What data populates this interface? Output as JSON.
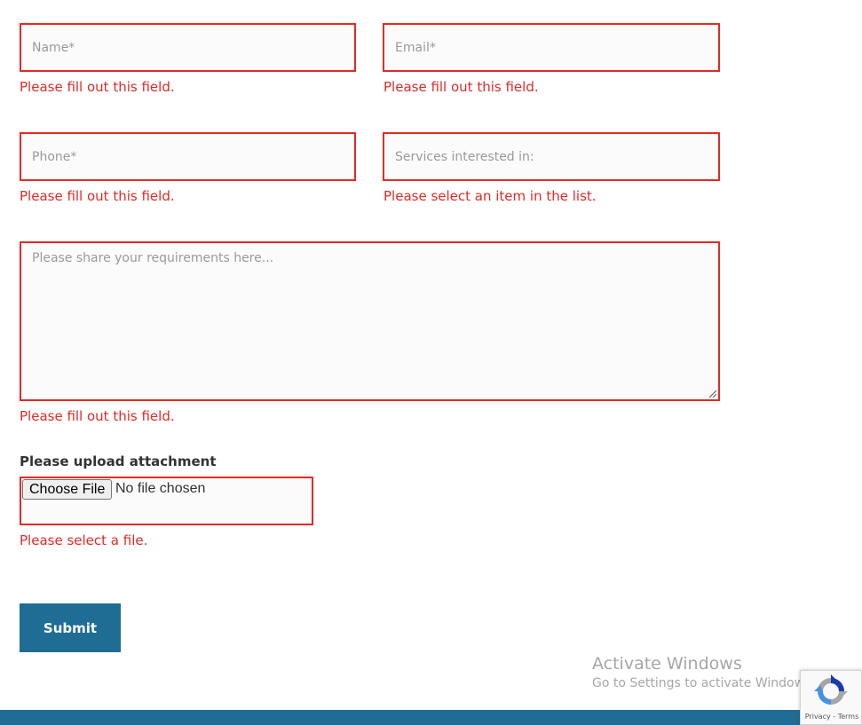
{
  "form": {
    "name": {
      "placeholder": "Name*",
      "error": "Please fill out this field."
    },
    "email": {
      "placeholder": "Email*",
      "error": "Please fill out this field."
    },
    "phone": {
      "placeholder": "Phone*",
      "error": "Please fill out this field."
    },
    "services": {
      "placeholder": "Services interested in:",
      "error": "Please select an item in the list."
    },
    "requirements": {
      "placeholder": "Please share your requirements here...",
      "error": "Please fill out this field."
    },
    "attachment": {
      "label": "Please upload attachment",
      "button_label": "Choose File",
      "status": "No file chosen",
      "error": "Please select a file."
    },
    "submit_label": "Submit"
  },
  "watermark": {
    "title": "Activate Windows",
    "subtitle": "Go to Settings to activate Windows."
  },
  "recaptcha": {
    "links": "Privacy - Terms"
  },
  "colors": {
    "error": "#e02b27",
    "accent": "#1f6d94",
    "field_bg": "#fbfbfb"
  }
}
